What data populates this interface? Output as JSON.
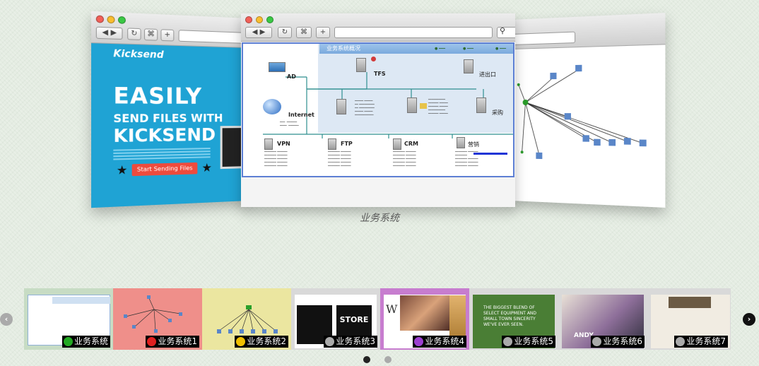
{
  "left_browser": {
    "brand": "Kicksend",
    "headline_1": "EASILY",
    "headline_2": "SEND FILES WITH",
    "headline_3": "KICKSEND",
    "cta": "Start Sending Files"
  },
  "center_browser": {
    "panel_title": "业务系统概况",
    "nodes": {
      "ad": "AD",
      "tfs": "TFS",
      "exit": "进出口",
      "internet": "Internet",
      "purchase": "采购",
      "vpn": "VPN",
      "ftp": "FTP",
      "crm": "CRM",
      "sales": "营销"
    },
    "caption": "业务系统"
  },
  "thumbnails": [
    {
      "label": "业务系统",
      "status": "ok",
      "status_color": "#22aa22"
    },
    {
      "label": "业务系统1",
      "status": "bad",
      "status_color": "#e02020"
    },
    {
      "label": "业务系统2",
      "status": "warn",
      "status_color": "#f0c000"
    },
    {
      "label": "业务系统3",
      "status": "disabled",
      "status_color": "#aaaaaa"
    },
    {
      "label": "业务系统4",
      "status": "tool",
      "status_color": "#9c3fd0"
    },
    {
      "label": "业务系统5",
      "status": "disabled",
      "status_color": "#aaaaaa"
    },
    {
      "label": "业务系统6",
      "status": "disabled",
      "status_color": "#aaaaaa"
    },
    {
      "label": "业务系统7",
      "status": "disabled",
      "status_color": "#aaaaaa"
    }
  ],
  "thumb_texts": {
    "t4_1": "STORE",
    "t6_1": "THE BIGGEST BLEND OF",
    "t6_2": "SELECT EQUIPMENT AND",
    "t6_3": "SMALL TOWN SINCERITY",
    "t6_4": "WE'VE EVER SEEN.",
    "t7_1": "ANDY"
  },
  "pagination": {
    "active_page": 1,
    "page_count": 2
  }
}
